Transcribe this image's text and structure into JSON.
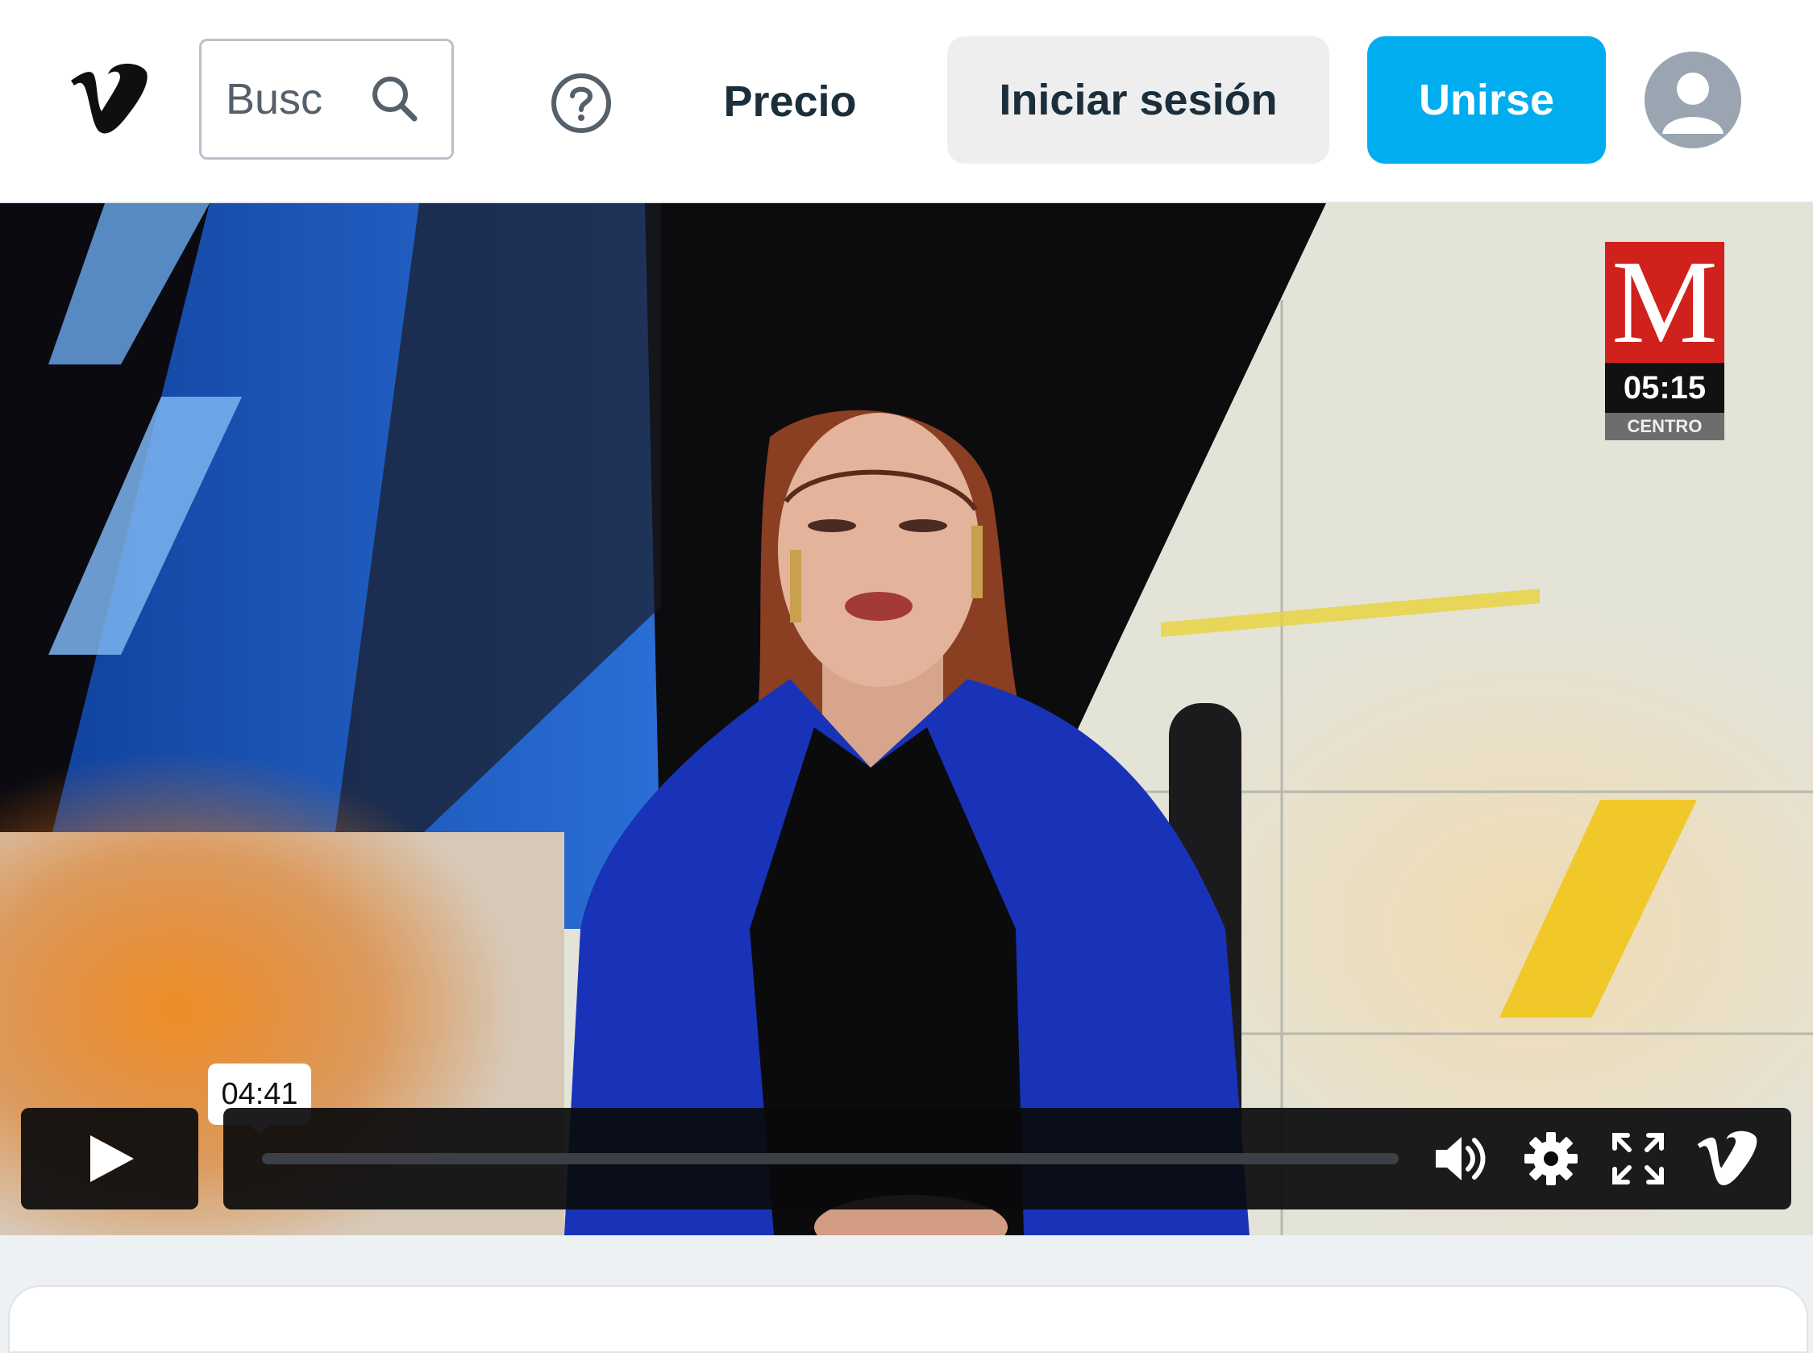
{
  "header": {
    "logo_icon": "vimeo-logo-icon",
    "search": {
      "placeholder": "Busc",
      "icon": "search-icon"
    },
    "help_icon": "help-circle-icon",
    "nav": {
      "pricing_label": "Precio"
    },
    "login_label": "Iniciar sesión",
    "join_label": "Unirse",
    "avatar_icon": "user-avatar-icon",
    "colors": {
      "join_button": "#00adef",
      "login_button": "#eeeeee",
      "text": "#1a2e3b"
    }
  },
  "video": {
    "channel_logo": {
      "letter": "M",
      "time": "05:15",
      "region": "CENTRO"
    },
    "controls": {
      "play_icon": "play-icon",
      "hover_time": "04:41",
      "progress": 0,
      "icons": [
        "volume-icon",
        "settings-icon",
        "fullscreen-icon",
        "vimeo-icon"
      ]
    }
  }
}
